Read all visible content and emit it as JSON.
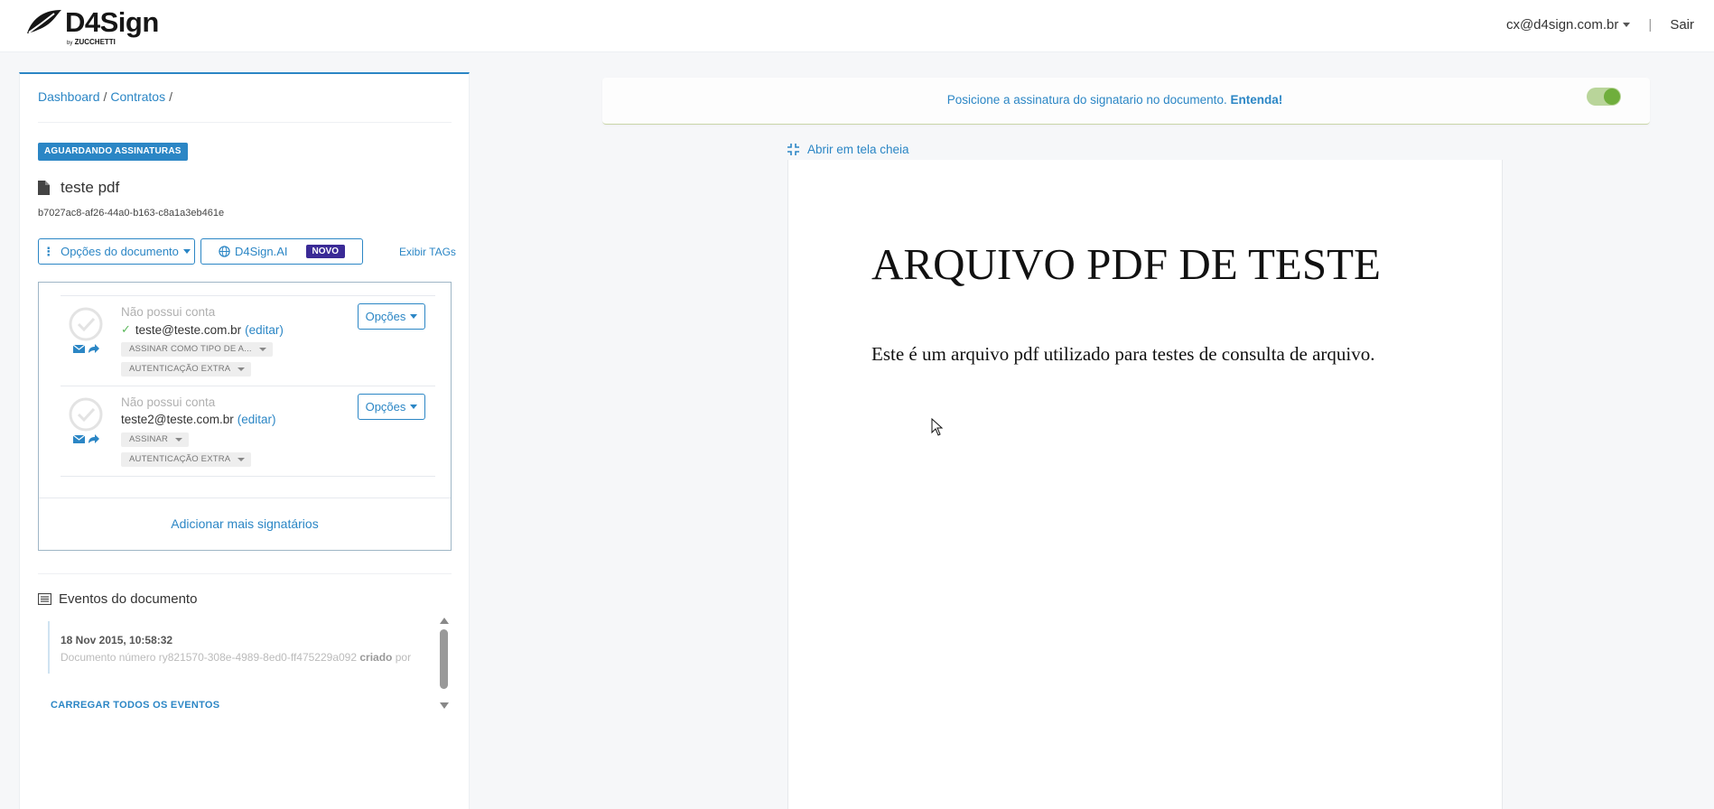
{
  "header": {
    "logo_name": "D4Sign",
    "logo_by": "by",
    "logo_company": "ZUCCHETTI",
    "user_email": "cx@d4sign.com.br",
    "separator": "|",
    "logout_label": "Sair"
  },
  "breadcrumb": {
    "items": [
      "Dashboard",
      "Contratos"
    ],
    "separator": "/"
  },
  "document": {
    "status": "AGUARDANDO ASSINATURAS",
    "title": "teste pdf",
    "id": "b7027ac8-af26-44a0-b163-c8a1a3eb461e",
    "options_label": "Opções do documento",
    "ai_label": "D4Sign.AI",
    "ai_badge": "NOVO",
    "tags_label": "Exibir TAGs"
  },
  "signers": [
    {
      "account": "Não possui conta",
      "email": "teste@teste.com.br",
      "edit_label": "(editar)",
      "verified": true,
      "sign_type": "ASSINAR COMO TIPO DE A...",
      "auth": "AUTENTICAÇÃO EXTRA",
      "options_label": "Opções"
    },
    {
      "account": "Não possui conta",
      "email": "teste2@teste.com.br",
      "edit_label": "(editar)",
      "verified": false,
      "sign_type": "ASSINAR",
      "auth": "AUTENTICAÇÃO EXTRA",
      "options_label": "Opções"
    }
  ],
  "add_signers_label": "Adicionar mais signatários",
  "events": {
    "title": "Eventos do documento",
    "items": [
      {
        "date": "18 Nov 2015, 10:58:32",
        "desc_prefix": "Documento número ry821570-308e-4989-8ed0-ff475229a092",
        "desc_action": "criado",
        "desc_suffix": "por"
      }
    ],
    "load_all_label": "CARREGAR TODOS OS EVENTOS"
  },
  "banner": {
    "text": "Posicione a assinatura do signatario no documento.",
    "link": "Entenda!",
    "toggle_on": true
  },
  "viewer": {
    "fullscreen_label": "Abrir em tela cheia",
    "pdf_title": "ARQUIVO PDF DE TESTE",
    "pdf_text": "Este é um arquivo pdf utilizado para testes de consulta de arquivo."
  },
  "colors": {
    "accent": "#2b86c5",
    "ai_badge": "#3a2a96",
    "toggle": "#6fae3c",
    "verified": "#5cb85c"
  }
}
